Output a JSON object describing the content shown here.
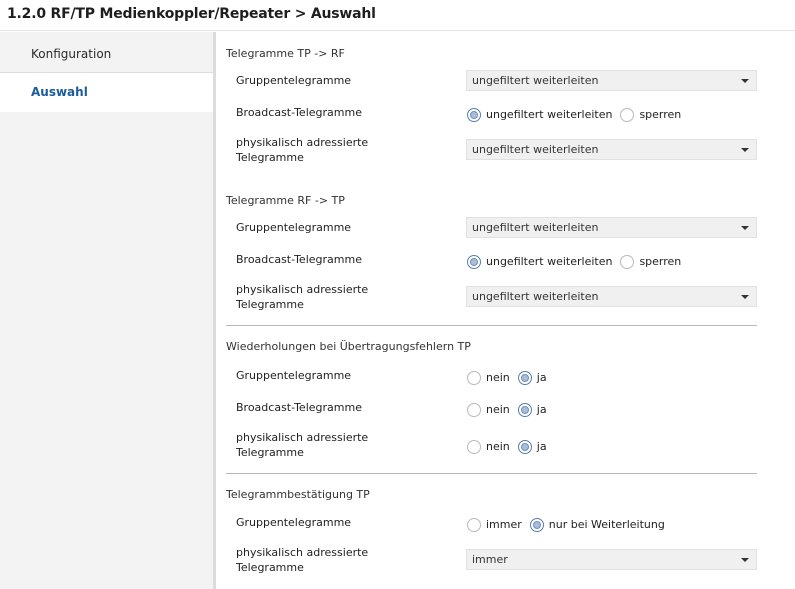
{
  "window": {
    "title": "1.2.0 RF/TP Medienkoppler/Repeater > Auswahl"
  },
  "sidebar": {
    "items": [
      {
        "label": "Konfiguration"
      },
      {
        "label": "Auswahl"
      }
    ]
  },
  "sections": {
    "tp_rf": {
      "title": "Telegramme TP -> RF",
      "gruppe": {
        "label": "Gruppentelegramme",
        "value": "ungefiltert weiterleiten"
      },
      "broadcast": {
        "label": "Broadcast-Telegramme",
        "options": [
          "ungefiltert weiterleiten",
          "sperren"
        ],
        "selected": "ungefiltert weiterleiten"
      },
      "phys": {
        "label_line1": "physikalisch adressierte",
        "label_line2": "Telegramme",
        "value": "ungefiltert weiterleiten"
      }
    },
    "rf_tp": {
      "title": "Telegramme RF -> TP",
      "gruppe": {
        "label": "Gruppentelegramme",
        "value": "ungefiltert weiterleiten"
      },
      "broadcast": {
        "label": "Broadcast-Telegramme",
        "options": [
          "ungefiltert weiterleiten",
          "sperren"
        ],
        "selected": "ungefiltert weiterleiten"
      },
      "phys": {
        "label_line1": "physikalisch adressierte",
        "label_line2": "Telegramme",
        "value": "ungefiltert weiterleiten"
      }
    },
    "wiederholungen": {
      "title": "Wiederholungen bei Übertragungsfehlern TP",
      "gruppe": {
        "label": "Gruppentelegramme",
        "options": [
          "nein",
          "ja"
        ],
        "selected": "ja"
      },
      "broadcast": {
        "label": "Broadcast-Telegramme",
        "options": [
          "nein",
          "ja"
        ],
        "selected": "ja"
      },
      "phys": {
        "label_line1": "physikalisch adressierte",
        "label_line2": "Telegramme",
        "options": [
          "nein",
          "ja"
        ],
        "selected": "ja"
      }
    },
    "bestaetigung": {
      "title": "Telegrammbestätigung TP",
      "gruppe": {
        "label": "Gruppentelegramme",
        "options": [
          "immer",
          "nur bei Weiterleitung"
        ],
        "selected": "nur bei Weiterleitung"
      },
      "phys": {
        "label_line1": "physikalisch adressierte",
        "label_line2": "Telegramme",
        "value": "immer"
      }
    }
  },
  "colors": {
    "accent": "#1b5c9c",
    "sidebar_bg": "#f3f3f3",
    "radio_checked": "#a8bedb"
  }
}
